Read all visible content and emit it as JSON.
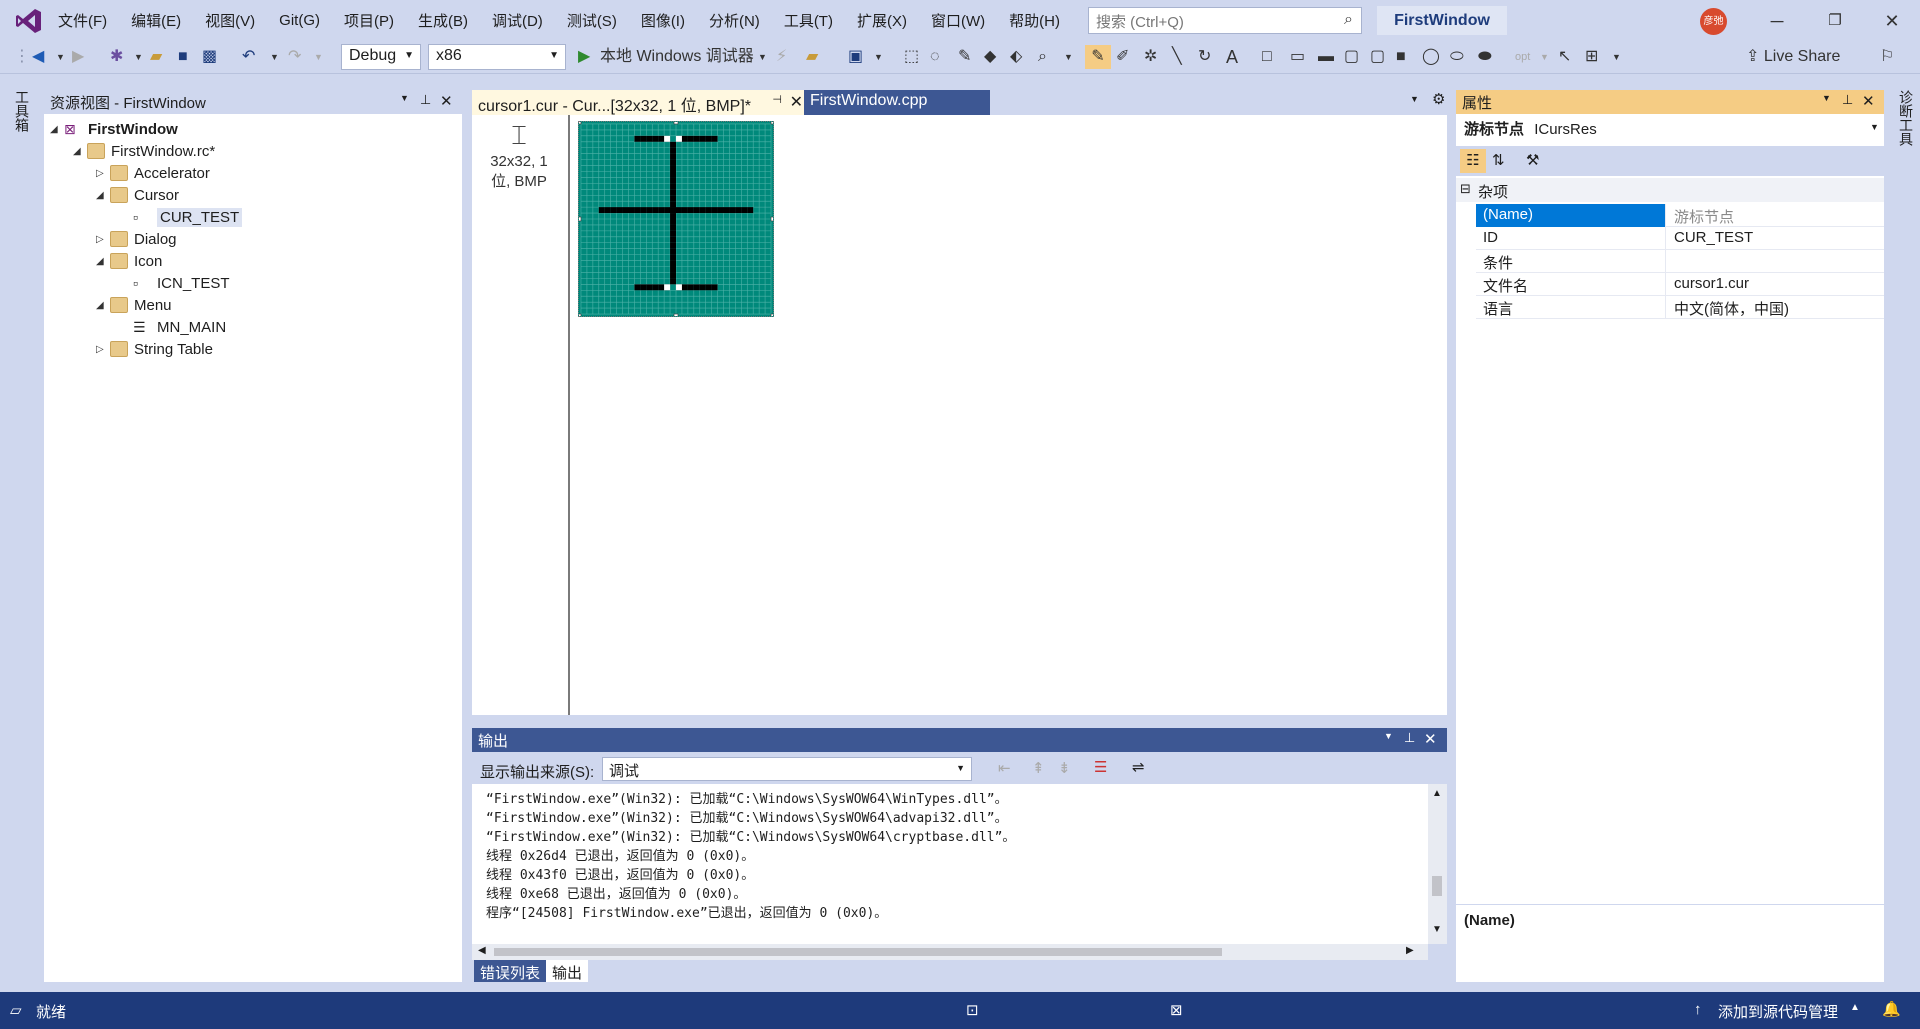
{
  "app": {
    "menu": [
      "文件(F)",
      "编辑(E)",
      "视图(V)",
      "Git(G)",
      "项目(P)",
      "生成(B)",
      "调试(D)",
      "测试(S)",
      "图像(I)",
      "分析(N)",
      "工具(T)",
      "扩展(X)",
      "窗口(W)",
      "帮助(H)"
    ],
    "search_placeholder": "搜索 (Ctrl+Q)",
    "project_name": "FirstWindow",
    "avatar_text": "彦弛",
    "accent_color": "#68217a"
  },
  "toolbar": {
    "config": "Debug",
    "platform": "x86",
    "debugger": "本地 Windows 调试器",
    "live_share": "Live Share",
    "opt_label": "opt"
  },
  "left_strip": {
    "label": "工具箱"
  },
  "right_strip": {
    "label": "诊断工具"
  },
  "resource_view": {
    "title": "资源视图 - FirstWindow",
    "tree": [
      {
        "label": "FirstWindow",
        "level": 0,
        "expander": "◢",
        "bold": true
      },
      {
        "label": "FirstWindow.rc*",
        "level": 1,
        "expander": "◢"
      },
      {
        "label": "Accelerator",
        "level": 2,
        "expander": "▷"
      },
      {
        "label": "Cursor",
        "level": 2,
        "expander": "◢"
      },
      {
        "label": "CUR_TEST",
        "level": 3,
        "expander": "",
        "selected": true
      },
      {
        "label": "Dialog",
        "level": 2,
        "expander": "▷"
      },
      {
        "label": "Icon",
        "level": 2,
        "expander": "◢"
      },
      {
        "label": "ICN_TEST",
        "level": 3,
        "expander": ""
      },
      {
        "label": "Menu",
        "level": 2,
        "expander": "◢"
      },
      {
        "label": "MN_MAIN",
        "level": 3,
        "expander": ""
      },
      {
        "label": "String Table",
        "level": 2,
        "expander": "▷"
      }
    ]
  },
  "editor": {
    "tabs": [
      {
        "label": "cursor1.cur - Cur...[32x32, 1 位, BMP]*",
        "active": true
      },
      {
        "label": "FirstWindow.cpp",
        "active": false
      }
    ],
    "thumb_caption_1": "32x32, 1",
    "thumb_caption_2": "位, BMP"
  },
  "output": {
    "title": "输出",
    "source_label": "显示输出来源(S):",
    "source_value": "调试",
    "lines": [
      "“FirstWindow.exe”(Win32): 已加载“C:\\Windows\\SysWOW64\\WinTypes.dll”。",
      "“FirstWindow.exe”(Win32): 已加载“C:\\Windows\\SysWOW64\\advapi32.dll”。",
      "“FirstWindow.exe”(Win32): 已加载“C:\\Windows\\SysWOW64\\cryptbase.dll”。",
      "线程 0x26d4 已退出，返回值为 0 (0x0)。",
      "线程 0x43f0 已退出，返回值为 0 (0x0)。",
      "线程 0xe68 已退出，返回值为 0 (0x0)。",
      "程序“[24508] FirstWindow.exe”已退出，返回值为 0 (0x0)。"
    ],
    "bottom_tabs": [
      "错误列表",
      "输出"
    ]
  },
  "properties": {
    "title": "属性",
    "object_label": "游标节点",
    "object_type": "ICursRes",
    "category": "杂项",
    "rows": [
      {
        "key": "(Name)",
        "value": "游标节点",
        "selected": true
      },
      {
        "key": "ID",
        "value": "CUR_TEST"
      },
      {
        "key": "条件",
        "value": ""
      },
      {
        "key": "文件名",
        "value": "cursor1.cur"
      },
      {
        "key": "语言",
        "value": "中文(简体，中国)"
      }
    ],
    "description_title": "(Name)"
  },
  "status": {
    "ready": "就绪",
    "source_control": "添加到源代码管理"
  }
}
